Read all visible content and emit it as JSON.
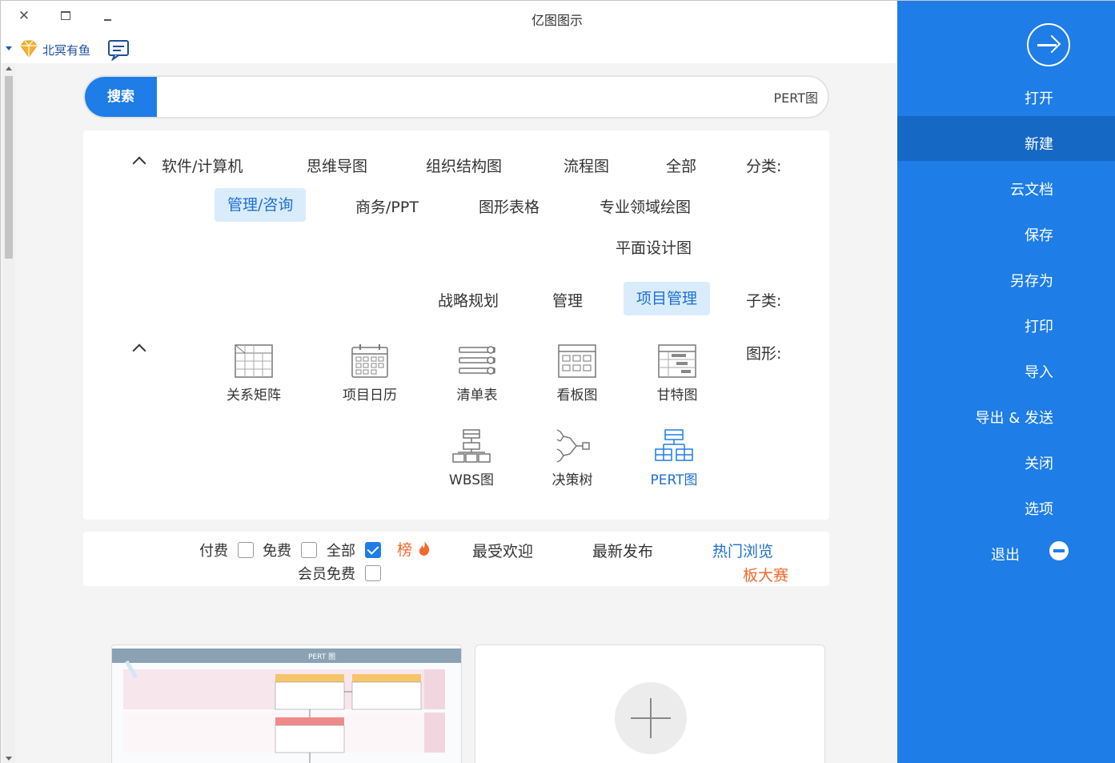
{
  "app": {
    "title": "亿图图示",
    "user_name": "北冥有鱼"
  },
  "search": {
    "button_label": "搜索",
    "value": "PERT图"
  },
  "filters": {
    "category_label": "分类:",
    "categories": [
      "全部",
      "流程图",
      "组织结构图",
      "思维导图",
      "软件/计算机",
      "专业领域绘图",
      "图形表格",
      "商务/PPT",
      "管理/咨询",
      "平面设计图"
    ],
    "active_category": "管理/咨询",
    "subcategory_label": "子类:",
    "subcategories": [
      "项目管理",
      "管理",
      "战略规划"
    ],
    "active_subcategory": "项目管理",
    "shapes_label": "图形:",
    "shapes": [
      {
        "label": "甘特图",
        "icon": "gantt-chart-icon"
      },
      {
        "label": "看板图",
        "icon": "kanban-icon"
      },
      {
        "label": "清单表",
        "icon": "checklist-icon"
      },
      {
        "label": "项目日历",
        "icon": "calendar-icon"
      },
      {
        "label": "关系矩阵",
        "icon": "matrix-table-icon"
      },
      {
        "label": "PERT图",
        "icon": "pert-chart-icon"
      },
      {
        "label": "决策树",
        "icon": "decision-tree-icon"
      },
      {
        "label": "WBS图",
        "icon": "wbs-chart-icon"
      }
    ],
    "active_shape": "PERT图"
  },
  "sort": {
    "items": [
      "热门浏览",
      "最新发布",
      "最受欢迎"
    ],
    "active": "热门浏览",
    "hot_tag": "榜",
    "contest_link": "板大赛",
    "checkboxes": [
      {
        "label": "全部",
        "checked": true
      },
      {
        "label": "免费",
        "checked": false
      },
      {
        "label": "付费",
        "checked": false
      },
      {
        "label": "会员免费",
        "checked": false
      }
    ]
  },
  "templates": {
    "pert_card_title": "PERT 图"
  },
  "sidebar": {
    "items": [
      "打开",
      "新建",
      "云文档",
      "保存",
      "另存为",
      "打印",
      "导入",
      "导出 & 发送",
      "关闭",
      "选项",
      "退出"
    ],
    "active": "新建"
  },
  "colors": {
    "accent": "#1e7de6",
    "sidebar_active": "#1568c4",
    "hot": "#f06a2c"
  }
}
